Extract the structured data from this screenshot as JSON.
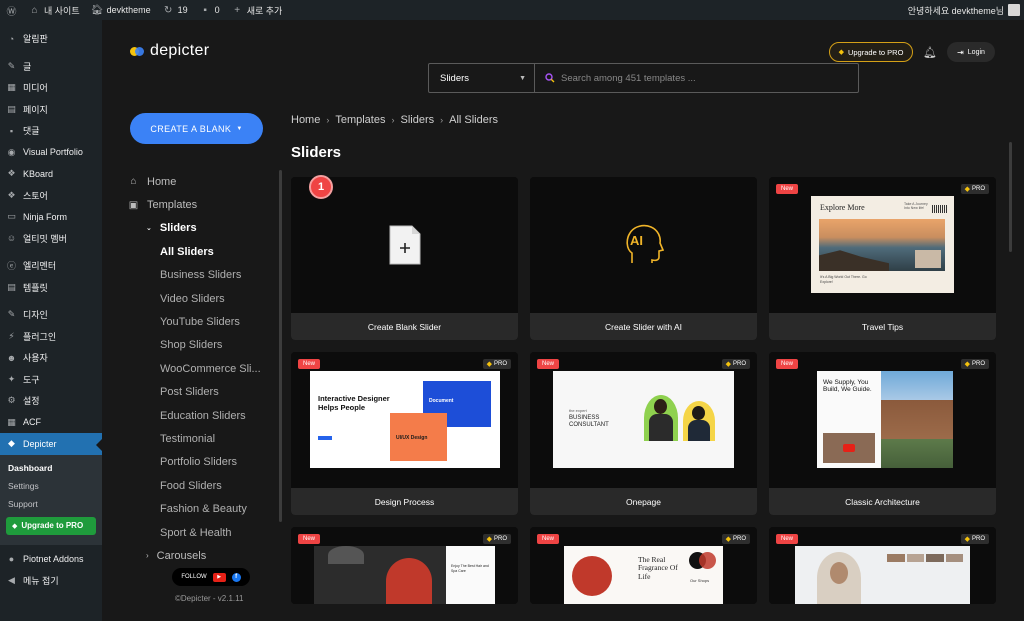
{
  "adminbar": {
    "site_name": "내 사이트",
    "theme_name": "devktheme",
    "updates_count": "19",
    "comments_count": "0",
    "new_label": "새로 추가",
    "greeting": "안녕하세요 devktheme님"
  },
  "wpmenu": {
    "items": [
      {
        "label": "알림판",
        "icon": "dashboard-icon"
      },
      {
        "label": "글",
        "icon": "pin-icon"
      },
      {
        "label": "미디어",
        "icon": "media-icon"
      },
      {
        "label": "페이지",
        "icon": "page-icon"
      },
      {
        "label": "댓글",
        "icon": "comment-icon"
      },
      {
        "label": "Visual Portfolio",
        "icon": "portfolio-icon"
      },
      {
        "label": "KBoard",
        "icon": "kboard-icon"
      },
      {
        "label": "스토어",
        "icon": "store-icon"
      },
      {
        "label": "Ninja Form",
        "icon": "form-icon"
      },
      {
        "label": "얼티밋 멤버",
        "icon": "member-icon"
      },
      {
        "label": "엘리멘터",
        "icon": "elementor-icon"
      },
      {
        "label": "템플릿",
        "icon": "template-icon"
      },
      {
        "label": "디자인",
        "icon": "brush-icon"
      },
      {
        "label": "플러그인",
        "icon": "plugin-icon"
      },
      {
        "label": "사용자",
        "icon": "user-icon"
      },
      {
        "label": "도구",
        "icon": "wrench-icon"
      },
      {
        "label": "설정",
        "icon": "settings-icon"
      },
      {
        "label": "ACF",
        "icon": "acf-icon"
      }
    ],
    "active_label": "Depicter",
    "submenu": [
      "Dashboard",
      "Settings",
      "Support"
    ],
    "upgrade_label": "Upgrade to PRO",
    "after": [
      {
        "label": "Piotnet Addons",
        "icon": "piotnet-icon"
      },
      {
        "label": "메뉴 접기",
        "icon": "collapse-icon"
      }
    ]
  },
  "header": {
    "logo_text": "depicter",
    "upgrade_label": "Upgrade to PRO",
    "login_label": "Login"
  },
  "search": {
    "select_value": "Sliders",
    "placeholder": "Search among 451 templates ..."
  },
  "sidebar": {
    "create_blank": "CREATE A BLANK",
    "home": "Home",
    "templates": "Templates",
    "sliders": "Sliders",
    "slider_items": [
      "All Sliders",
      "Business Sliders",
      "Video Sliders",
      "YouTube Sliders",
      "Shop Sliders",
      "WooCommerce Sli...",
      "Post Sliders",
      "Education Sliders",
      "Testimonial",
      "Portfolio Sliders",
      "Food Sliders",
      "Fashion & Beauty",
      "Sport & Health"
    ],
    "carousels": "Carousels",
    "follow_label": "FOLLOW",
    "version": "©Depicter - v2.1.11"
  },
  "breadcrumb": [
    "Home",
    "Templates",
    "Sliders",
    "All Sliders"
  ],
  "page_title": "Sliders",
  "step_number": "1",
  "badges": {
    "new": "New",
    "pro": "PRO"
  },
  "cards": [
    {
      "label": "Create Blank Slider"
    },
    {
      "label": "Create Slider with AI",
      "ai_text": "AI"
    },
    {
      "label": "Travel Tips",
      "preview_title": "Explore More",
      "preview_note": "Take A Journey Into New life!",
      "preview_foot": "It's A Big World Out There. Go Explore!"
    },
    {
      "label": "Design Process",
      "preview_title": "Interactive Designer Helps People",
      "preview_doc": "Document",
      "preview_tag": "UI/UX Design"
    },
    {
      "label": "Onepage",
      "preview_small": "the expert",
      "preview_title": "BUSINESS CONSULTANT"
    },
    {
      "label": "Classic Architecture",
      "preview_title": "We Supply, You Build, We Guide."
    },
    {
      "preview_text": "Enjoy The Best Hair and Spa Care"
    },
    {
      "preview_title": "The Real Fragrance Of Life",
      "preview_sub": "Our Shops"
    },
    {}
  ],
  "colors": {
    "accent": "#3b82f6",
    "new_badge": "#ef4444",
    "pro_gem": "#f4c20d",
    "wp_active": "#2271b1",
    "upgrade_green": "#1f9b3c"
  }
}
